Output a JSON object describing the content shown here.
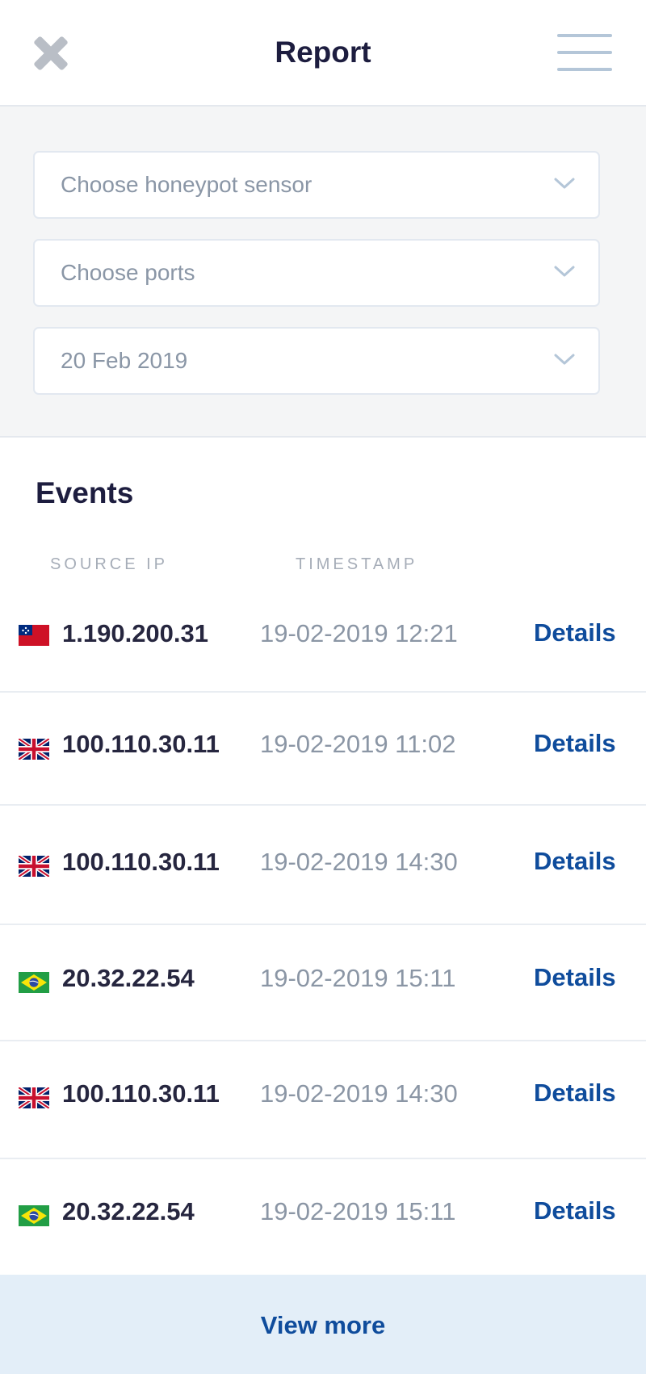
{
  "header": {
    "title": "Report",
    "close_icon": "close-icon",
    "menu_icon": "hamburger-menu-icon"
  },
  "filters": {
    "sensor_placeholder": "Choose honeypot sensor",
    "ports_placeholder": "Choose ports",
    "date_value": "20 Feb 2019",
    "dropdown_icon": "chevron-down-icon"
  },
  "events": {
    "title": "Events",
    "col_source_ip": "SOURCE IP",
    "col_timestamp": "TIMESTAMP",
    "details_label": "Details",
    "rows": [
      {
        "flag": "samoa",
        "ip": "1.190.200.31",
        "timestamp": "19-02-2019 12:21"
      },
      {
        "flag": "uk",
        "ip": "100.110.30.11",
        "timestamp": "19-02-2019 11:02"
      },
      {
        "flag": "uk",
        "ip": "100.110.30.11",
        "timestamp": "19-02-2019 14:30"
      },
      {
        "flag": "brazil",
        "ip": "20.32.22.54",
        "timestamp": "19-02-2019 15:11"
      },
      {
        "flag": "uk",
        "ip": "100.110.30.11",
        "timestamp": "19-02-2019 14:30"
      },
      {
        "flag": "brazil",
        "ip": "20.32.22.54",
        "timestamp": "19-02-2019 15:11"
      }
    ]
  },
  "view_more_label": "View more",
  "colors": {
    "accent": "#0f4c9c",
    "title": "#1d1d3f",
    "muted": "#8b96a5",
    "filters_bg": "#f4f5f6",
    "view_more_bg": "#e3eef8"
  }
}
